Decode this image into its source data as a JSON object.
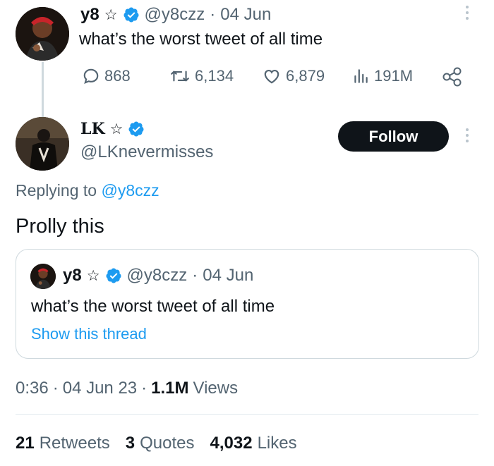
{
  "parent_tweet": {
    "name": "y8",
    "star": "☆",
    "handle": "@y8czz",
    "separator": "·",
    "date": "04 Jun",
    "text": "what’s the worst tweet of all time",
    "stats": {
      "replies": "868",
      "retweets": "6,134",
      "likes": "6,879",
      "views": "191M"
    }
  },
  "reply": {
    "name": "LK",
    "star": "☆",
    "handle": "@LKnevermisses",
    "follow_label": "Follow",
    "replying_prefix": "Replying to",
    "replying_handle": "@y8czz",
    "text": "Prolly this",
    "time": "0:36",
    "date": "04 Jun 23",
    "views_count": "1.1M",
    "views_label": "Views",
    "separator": "·"
  },
  "quoted_tweet": {
    "name": "y8",
    "star": "☆",
    "handle": "@y8czz",
    "separator": "·",
    "date": "04 Jun",
    "text": "what’s the worst tweet of all time",
    "show_thread": "Show this thread"
  },
  "engagement": {
    "retweets_count": "21",
    "retweets_label": "Retweets",
    "quotes_count": "3",
    "quotes_label": "Quotes",
    "likes_count": "4,032",
    "likes_label": "Likes"
  },
  "colors": {
    "accent": "#1d9bf0",
    "text": "#0f1419",
    "secondary": "#536471",
    "verified": "#1d9bf0"
  }
}
